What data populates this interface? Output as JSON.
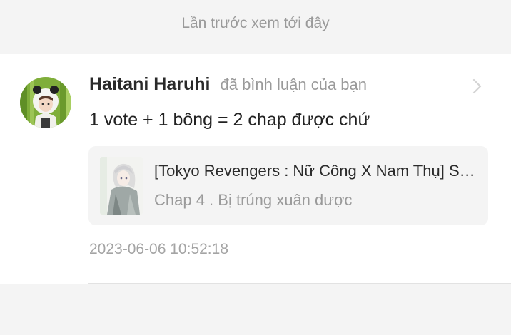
{
  "banner": {
    "text": "Lần trước xem tới đây"
  },
  "notification": {
    "user_name": "Haitani Haruhi",
    "action": "đã bình luận của bạn",
    "comment": "1 vote + 1 bông = 2 chap được chứ",
    "reference": {
      "title": "[Tokyo Revengers : Nữ Công X Nam Thụ] Sa Ngã",
      "chapter": "Chap 4 . Bị trúng xuân dược"
    },
    "timestamp": "2023-06-06 10:52:18"
  },
  "icons": {
    "avatar": "user-avatar-panda-hood",
    "thumbnail": "manga-cover-thumbnail",
    "chevron": "chevron-right-icon"
  },
  "colors": {
    "card_bg": "#ffffff",
    "page_bg": "#f4f4f4",
    "muted_text": "#9a9a9a",
    "primary_text": "#222222"
  }
}
